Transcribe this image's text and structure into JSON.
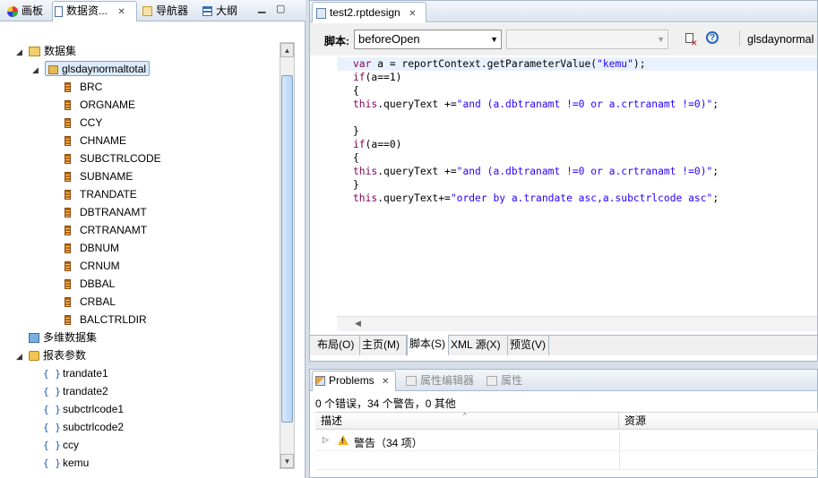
{
  "left_tabs": [
    {
      "label": "画板"
    },
    {
      "label": "数据资..."
    },
    {
      "label": "导航器"
    },
    {
      "label": "大纲"
    }
  ],
  "left_tab_close": "✕",
  "tree": {
    "datasets_label": "数据集",
    "dataset_name": "glsdaynormaltotal",
    "columns": [
      "BRC",
      "ORGNAME",
      "CCY",
      "CHNAME",
      "SUBCTRLCODE",
      "SUBNAME",
      "TRANDATE",
      "DBTRANAMT",
      "CRTRANAMT",
      "DBNUM",
      "CRNUM",
      "DBBAL",
      "CRBAL",
      "BALCTRLDIR"
    ],
    "cubes_label": "多维数据集",
    "params_label": "报表参数",
    "params": [
      "trandate1",
      "trandate2",
      "subctrlcode1",
      "subctrlcode2",
      "ccy",
      "kemu"
    ]
  },
  "editor": {
    "tab_title": "test2.rptdesign",
    "script_label": "脚本:",
    "event_combo": "beforeOpen",
    "second_combo": "",
    "dataset_label": "glsdaynormal",
    "code_lines": [
      [
        {
          "t": "var ",
          "c": "kw"
        },
        {
          "t": "a = reportContext.getParameterValue(",
          "c": ""
        },
        {
          "t": "\"kemu\"",
          "c": "st"
        },
        {
          "t": ");",
          "c": ""
        }
      ],
      [
        {
          "t": "if",
          "c": "kw"
        },
        {
          "t": "(a==1)",
          "c": ""
        }
      ],
      [
        {
          "t": "{",
          "c": ""
        }
      ],
      [
        {
          "t": "this",
          "c": "kw"
        },
        {
          "t": ".queryText +=",
          "c": ""
        },
        {
          "t": "\"and (a.dbtranamt !=0 or a.crtranamt !=0)\"",
          "c": "st"
        },
        {
          "t": ";",
          "c": ""
        }
      ],
      [
        {
          "t": "",
          "c": ""
        }
      ],
      [
        {
          "t": "}",
          "c": ""
        }
      ],
      [
        {
          "t": "if",
          "c": "kw"
        },
        {
          "t": "(a==0)",
          "c": ""
        }
      ],
      [
        {
          "t": "{",
          "c": ""
        }
      ],
      [
        {
          "t": "this",
          "c": "kw"
        },
        {
          "t": ".queryText +=",
          "c": ""
        },
        {
          "t": "\"and (a.dbtranamt !=0 or a.crtranamt !=0)\"",
          "c": "st"
        },
        {
          "t": ";",
          "c": ""
        }
      ],
      [
        {
          "t": "}",
          "c": ""
        }
      ],
      [
        {
          "t": "this",
          "c": "kw"
        },
        {
          "t": ".queryText+=",
          "c": ""
        },
        {
          "t": "\"order by a.trandate asc,a.subctrlcode asc\"",
          "c": "st"
        },
        {
          "t": ";",
          "c": ""
        }
      ]
    ],
    "bottom_tabs": [
      "布局(O)",
      "主页(M)",
      "脚本(S)",
      "XML 源(X)",
      "预览(V)"
    ]
  },
  "problems": {
    "tabs": [
      "Problems",
      "属性编辑器",
      "属性"
    ],
    "summary": "0 个错误，34 个警告，0 其他",
    "col_description": "描述",
    "col_resource": "资源",
    "warning_row": "警告（34 项）"
  },
  "colors": {
    "keyword": "#7f0055",
    "string": "#2a00ff",
    "selection": "#dcebfc"
  }
}
